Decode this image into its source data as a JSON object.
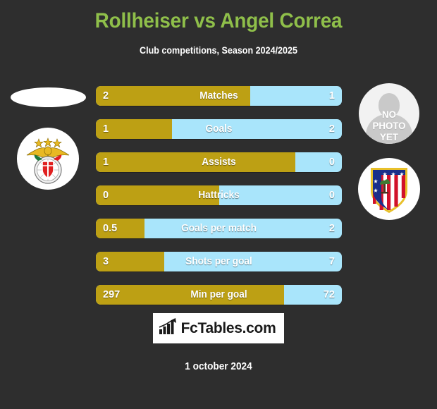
{
  "header": {
    "title": "Rollheiser vs Angel Correa",
    "subtitle": "Club competitions, Season 2024/2025"
  },
  "left_player": {
    "club_crest": "benfica-crest",
    "photo": "player-photo-partial"
  },
  "right_player": {
    "club_crest": "atletico-madrid-crest",
    "photo_placeholder_line1": "NO",
    "photo_placeholder_line2": "PHOTO",
    "photo_placeholder_line3": "YET"
  },
  "colors": {
    "background": "#2e2e2e",
    "title": "#8fbf4a",
    "home_bar": "#bda014",
    "away_bar": "#a9e5fb",
    "value_text": "#ffffff"
  },
  "chart_data": {
    "type": "bar",
    "title": "Rollheiser vs Angel Correa",
    "subtitle": "Club competitions, Season 2024/2025",
    "orientation": "horizontal-diverging",
    "series": [
      {
        "name": "Rollheiser",
        "color": "#bda014"
      },
      {
        "name": "Angel Correa",
        "color": "#a9e5fb"
      }
    ],
    "categories": [
      "Matches",
      "Goals",
      "Assists",
      "Hattricks",
      "Goals per match",
      "Shots per goal",
      "Min per goal"
    ],
    "rows": [
      {
        "label": "Matches",
        "home": "2",
        "away": "1",
        "home_pct": 62.8
      },
      {
        "label": "Goals",
        "home": "1",
        "away": "2",
        "home_pct": 31.0
      },
      {
        "label": "Assists",
        "home": "1",
        "away": "0",
        "home_pct": 81.0
      },
      {
        "label": "Hattricks",
        "home": "0",
        "away": "0",
        "home_pct": 50.0
      },
      {
        "label": "Goals per match",
        "home": "0.5",
        "away": "2",
        "home_pct": 19.8
      },
      {
        "label": "Shots per goal",
        "home": "3",
        "away": "7",
        "home_pct": 27.8
      },
      {
        "label": "Min per goal",
        "home": "297",
        "away": "72",
        "home_pct": 76.5
      }
    ]
  },
  "footer": {
    "brand": "FcTables.com",
    "brand_icon": "bar-chart-icon",
    "date": "1 october 2024"
  }
}
